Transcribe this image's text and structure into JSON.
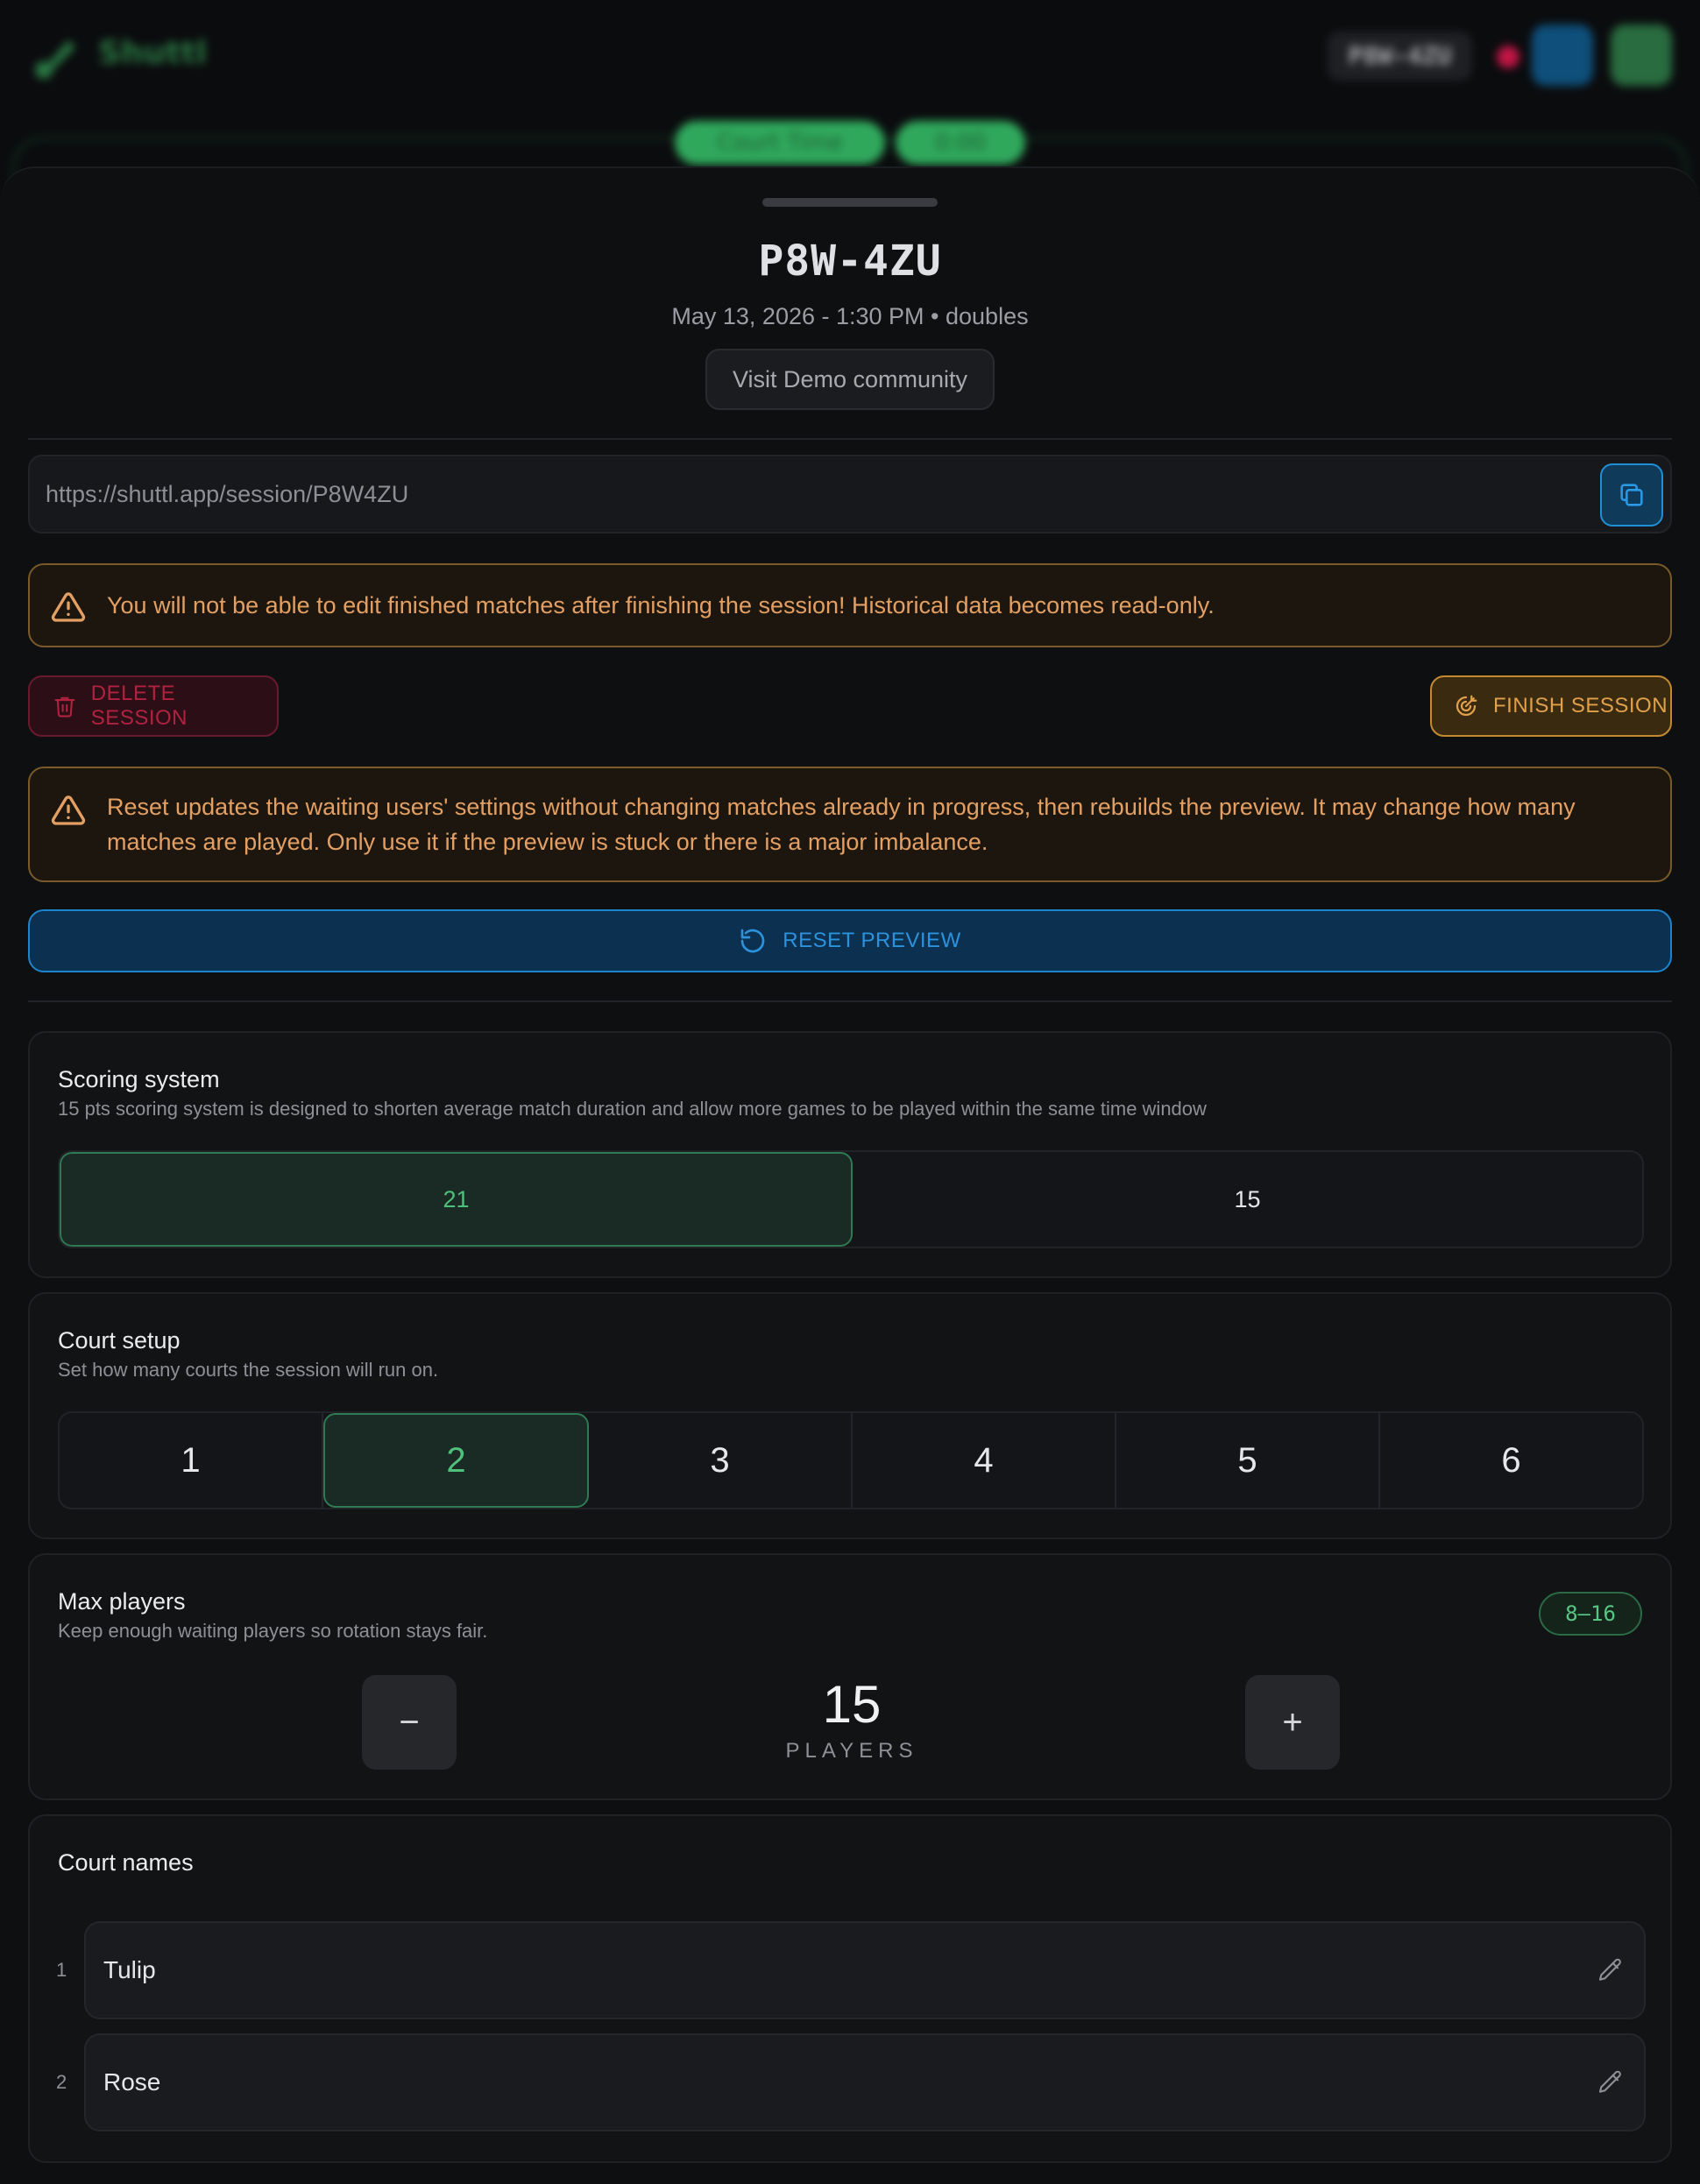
{
  "background": {
    "brand": "Shuttl",
    "session_code": "P8W-4ZU",
    "chips": [
      "Court Time",
      "0:00"
    ]
  },
  "sheet": {
    "title": "P8W-4ZU",
    "subtitle": "May 13, 2026 - 1:30 PM • doubles",
    "community_button": "Visit Demo community",
    "share_url": "https://shuttl.app/session/P8W4ZU",
    "finish_warning": "You will not be able to edit finished matches after finishing the session! Historical data becomes read-only.",
    "delete_label": "DELETE SESSION",
    "finish_label": "FINISH SESSION",
    "reset_warning": "Reset updates the waiting users' settings without changing matches already in progress, then rebuilds the preview. It may change how many matches are played. Only use it if the preview is stuck or there is a major imbalance.",
    "reset_label": "RESET PREVIEW"
  },
  "scoring": {
    "title": "Scoring system",
    "description": "15 pts scoring system is designed to shorten average match duration and allow more games to be played within the same time window",
    "options": [
      "21",
      "15"
    ],
    "selected": "21"
  },
  "courts": {
    "title": "Court setup",
    "description": "Set how many courts the session will run on.",
    "options": [
      "1",
      "2",
      "3",
      "4",
      "5",
      "6"
    ],
    "selected": "2"
  },
  "max_players": {
    "title": "Max players",
    "description": "Keep enough waiting players so rotation stays fair.",
    "range": "8–16",
    "value": "15",
    "unit": "PLAYERS",
    "minus": "−",
    "plus": "+"
  },
  "court_names": {
    "title": "Court names",
    "items": [
      {
        "index": "1",
        "name": "Tulip"
      },
      {
        "index": "2",
        "name": "Rose"
      }
    ]
  },
  "colors": {
    "accent_green": "#4fc17a",
    "accent_blue": "#1f8fd8",
    "warning": "#e4a063",
    "danger": "#b0223f"
  }
}
